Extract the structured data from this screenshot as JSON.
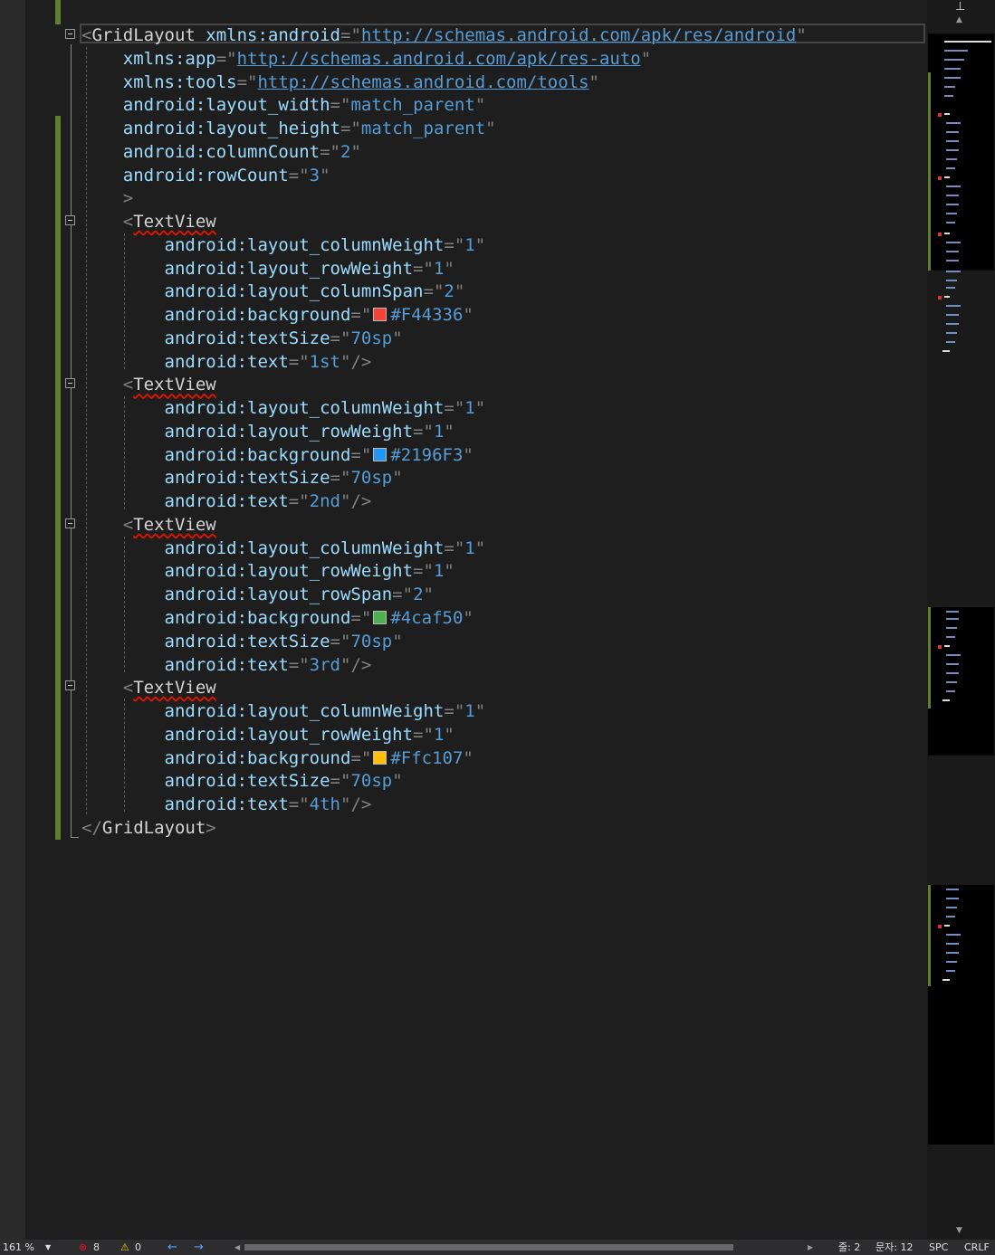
{
  "editor": {
    "language": "xml",
    "lines": [
      {
        "tokens": [
          {
            "c": "d",
            "t": "<"
          },
          {
            "c": "t",
            "t": "GridLayout"
          },
          {
            "c": "a",
            "t": " xmlns:android"
          },
          {
            "c": "d",
            "t": "=\""
          },
          {
            "c": "u",
            "t": "http://schemas.android.com/apk/res/android"
          },
          {
            "c": "d",
            "t": "\""
          }
        ]
      },
      {
        "tokens": [
          {
            "c": "a",
            "t": "    xmlns:app"
          },
          {
            "c": "d",
            "t": "=\""
          },
          {
            "c": "u",
            "t": "http://schemas.android.com/apk/res-auto"
          },
          {
            "c": "d",
            "t": "\""
          }
        ]
      },
      {
        "tokens": [
          {
            "c": "a",
            "t": "    xmlns:tools"
          },
          {
            "c": "d",
            "t": "=\""
          },
          {
            "c": "u",
            "t": "http://schemas.android.com/tools"
          },
          {
            "c": "d",
            "t": "\""
          }
        ]
      },
      {
        "tokens": [
          {
            "c": "a",
            "t": "    android:layout_width"
          },
          {
            "c": "d",
            "t": "=\""
          },
          {
            "c": "v",
            "t": "match_parent"
          },
          {
            "c": "d",
            "t": "\""
          }
        ]
      },
      {
        "tokens": [
          {
            "c": "a",
            "t": "    android:layout_height"
          },
          {
            "c": "d",
            "t": "=\""
          },
          {
            "c": "v",
            "t": "match_parent"
          },
          {
            "c": "d",
            "t": "\""
          }
        ]
      },
      {
        "tokens": [
          {
            "c": "a",
            "t": "    android:columnCount"
          },
          {
            "c": "d",
            "t": "=\""
          },
          {
            "c": "v",
            "t": "2"
          },
          {
            "c": "d",
            "t": "\""
          }
        ]
      },
      {
        "tokens": [
          {
            "c": "a",
            "t": "    android:rowCount"
          },
          {
            "c": "d",
            "t": "=\""
          },
          {
            "c": "v",
            "t": "3"
          },
          {
            "c": "d",
            "t": "\""
          }
        ]
      },
      {
        "tokens": [
          {
            "c": "d",
            "t": "    >"
          }
        ]
      },
      {
        "tokens": [
          {
            "c": "d",
            "t": "    <"
          },
          {
            "c": "t",
            "t": "TextView",
            "squig": true
          }
        ]
      },
      {
        "tokens": [
          {
            "c": "a",
            "t": "        android:layout_columnWeight"
          },
          {
            "c": "d",
            "t": "=\""
          },
          {
            "c": "v",
            "t": "1"
          },
          {
            "c": "d",
            "t": "\""
          }
        ]
      },
      {
        "tokens": [
          {
            "c": "a",
            "t": "        android:layout_rowWeight"
          },
          {
            "c": "d",
            "t": "=\""
          },
          {
            "c": "v",
            "t": "1"
          },
          {
            "c": "d",
            "t": "\""
          }
        ]
      },
      {
        "tokens": [
          {
            "c": "a",
            "t": "        android:layout_columnSpan"
          },
          {
            "c": "d",
            "t": "=\""
          },
          {
            "c": "v",
            "t": "2"
          },
          {
            "c": "d",
            "t": "\""
          }
        ]
      },
      {
        "tokens": [
          {
            "c": "a",
            "t": "        android:background"
          },
          {
            "c": "d",
            "t": "=\""
          },
          {
            "c": "v",
            "t": "#F44336",
            "swatch": "#F44336"
          },
          {
            "c": "d",
            "t": "\""
          }
        ]
      },
      {
        "tokens": [
          {
            "c": "a",
            "t": "        android:textSize"
          },
          {
            "c": "d",
            "t": "=\""
          },
          {
            "c": "v",
            "t": "70sp"
          },
          {
            "c": "d",
            "t": "\""
          }
        ]
      },
      {
        "tokens": [
          {
            "c": "a",
            "t": "        android:text"
          },
          {
            "c": "d",
            "t": "=\""
          },
          {
            "c": "v",
            "t": "1st"
          },
          {
            "c": "d",
            "t": "\"/>"
          }
        ]
      },
      {
        "tokens": [
          {
            "c": "d",
            "t": "    <"
          },
          {
            "c": "t",
            "t": "TextView",
            "squig": true
          }
        ]
      },
      {
        "tokens": [
          {
            "c": "a",
            "t": "        android:layout_columnWeight"
          },
          {
            "c": "d",
            "t": "=\""
          },
          {
            "c": "v",
            "t": "1"
          },
          {
            "c": "d",
            "t": "\""
          }
        ]
      },
      {
        "tokens": [
          {
            "c": "a",
            "t": "        android:layout_rowWeight"
          },
          {
            "c": "d",
            "t": "=\""
          },
          {
            "c": "v",
            "t": "1"
          },
          {
            "c": "d",
            "t": "\""
          }
        ]
      },
      {
        "tokens": [
          {
            "c": "a",
            "t": "        android:background"
          },
          {
            "c": "d",
            "t": "=\""
          },
          {
            "c": "v",
            "t": "#2196F3",
            "swatch": "#2196F3"
          },
          {
            "c": "d",
            "t": "\""
          }
        ]
      },
      {
        "tokens": [
          {
            "c": "a",
            "t": "        android:textSize"
          },
          {
            "c": "d",
            "t": "=\""
          },
          {
            "c": "v",
            "t": "70sp"
          },
          {
            "c": "d",
            "t": "\""
          }
        ]
      },
      {
        "tokens": [
          {
            "c": "a",
            "t": "        android:text"
          },
          {
            "c": "d",
            "t": "=\""
          },
          {
            "c": "v",
            "t": "2nd"
          },
          {
            "c": "d",
            "t": "\"/>"
          }
        ]
      },
      {
        "tokens": [
          {
            "c": "d",
            "t": "    <"
          },
          {
            "c": "t",
            "t": "TextView",
            "squig": true
          }
        ]
      },
      {
        "tokens": [
          {
            "c": "a",
            "t": "        android:layout_columnWeight"
          },
          {
            "c": "d",
            "t": "=\""
          },
          {
            "c": "v",
            "t": "1"
          },
          {
            "c": "d",
            "t": "\""
          }
        ]
      },
      {
        "tokens": [
          {
            "c": "a",
            "t": "        android:layout_rowWeight"
          },
          {
            "c": "d",
            "t": "=\""
          },
          {
            "c": "v",
            "t": "1"
          },
          {
            "c": "d",
            "t": "\""
          }
        ]
      },
      {
        "tokens": [
          {
            "c": "a",
            "t": "        android:layout_rowSpan"
          },
          {
            "c": "d",
            "t": "=\""
          },
          {
            "c": "v",
            "t": "2"
          },
          {
            "c": "d",
            "t": "\""
          }
        ]
      },
      {
        "tokens": [
          {
            "c": "a",
            "t": "        android:background"
          },
          {
            "c": "d",
            "t": "=\""
          },
          {
            "c": "v",
            "t": "#4caf50",
            "swatch": "#4caf50"
          },
          {
            "c": "d",
            "t": "\""
          }
        ]
      },
      {
        "tokens": [
          {
            "c": "a",
            "t": "        android:textSize"
          },
          {
            "c": "d",
            "t": "=\""
          },
          {
            "c": "v",
            "t": "70sp"
          },
          {
            "c": "d",
            "t": "\""
          }
        ]
      },
      {
        "tokens": [
          {
            "c": "a",
            "t": "        android:text"
          },
          {
            "c": "d",
            "t": "=\""
          },
          {
            "c": "v",
            "t": "3rd"
          },
          {
            "c": "d",
            "t": "\"/>"
          }
        ]
      },
      {
        "tokens": [
          {
            "c": "d",
            "t": "    <"
          },
          {
            "c": "t",
            "t": "TextView",
            "squig": true
          }
        ]
      },
      {
        "tokens": [
          {
            "c": "a",
            "t": "        android:layout_columnWeight"
          },
          {
            "c": "d",
            "t": "=\""
          },
          {
            "c": "v",
            "t": "1"
          },
          {
            "c": "d",
            "t": "\""
          }
        ]
      },
      {
        "tokens": [
          {
            "c": "a",
            "t": "        android:layout_rowWeight"
          },
          {
            "c": "d",
            "t": "=\""
          },
          {
            "c": "v",
            "t": "1"
          },
          {
            "c": "d",
            "t": "\""
          }
        ]
      },
      {
        "tokens": [
          {
            "c": "a",
            "t": "        android:background"
          },
          {
            "c": "d",
            "t": "=\""
          },
          {
            "c": "v",
            "t": "#Ffc107",
            "swatch": "#FFC107"
          },
          {
            "c": "d",
            "t": "\""
          }
        ]
      },
      {
        "tokens": [
          {
            "c": "a",
            "t": "        android:textSize"
          },
          {
            "c": "d",
            "t": "=\""
          },
          {
            "c": "v",
            "t": "70sp"
          },
          {
            "c": "d",
            "t": "\""
          }
        ]
      },
      {
        "tokens": [
          {
            "c": "a",
            "t": "        android:text"
          },
          {
            "c": "d",
            "t": "=\""
          },
          {
            "c": "v",
            "t": "4th"
          },
          {
            "c": "d",
            "t": "\"/>"
          }
        ]
      },
      {
        "tokens": [
          {
            "c": "d",
            "t": "</"
          },
          {
            "c": "t",
            "t": "GridLayout"
          },
          {
            "c": "d",
            "t": ">"
          }
        ]
      }
    ]
  },
  "status": {
    "zoom": "161 %",
    "errors": "8",
    "warnings": "0",
    "line": "줄: 2",
    "char": "문자: 12",
    "indent": "SPC",
    "eol": "CRLF"
  },
  "colors": {
    "background": "#1e1e1e",
    "tag": "#d4d4d4",
    "attribute": "#9cdcfe",
    "value": "#569cd6",
    "delimiter": "#808080",
    "change_marker": "#5f7f2e",
    "error": "#e51400"
  }
}
